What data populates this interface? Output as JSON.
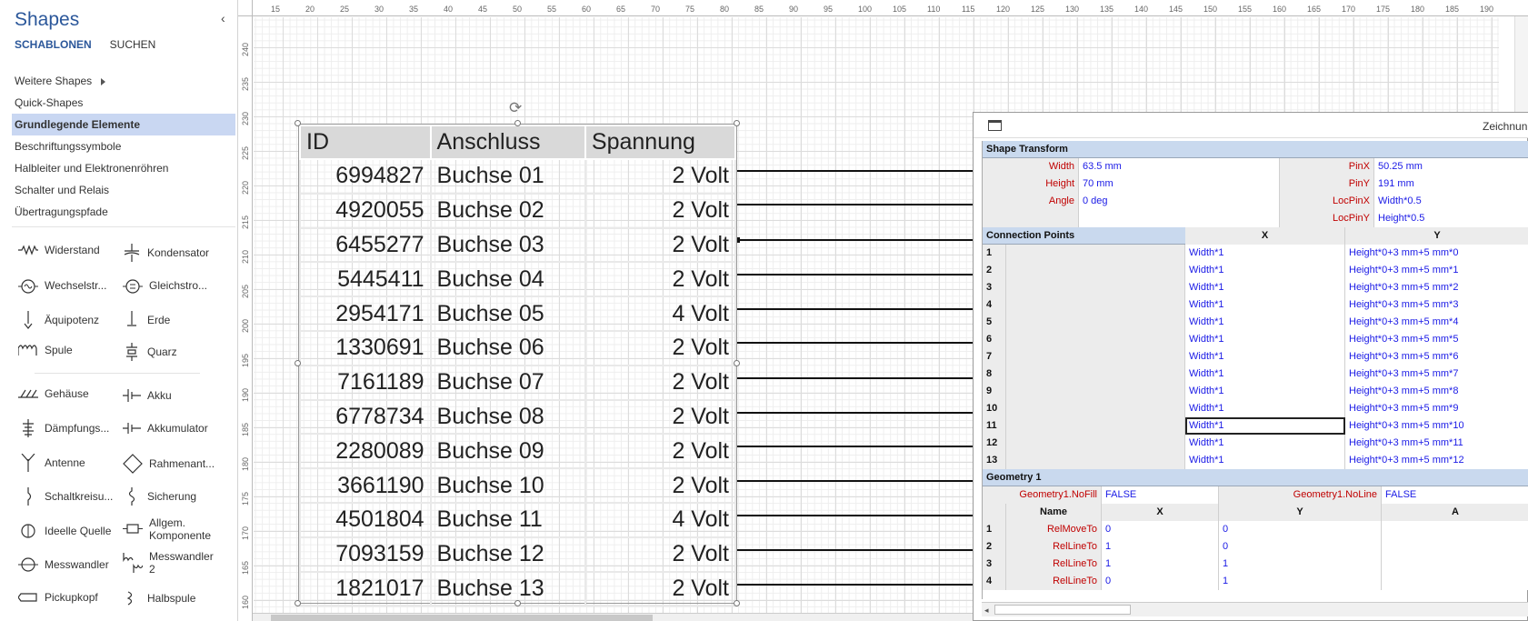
{
  "shapes_panel": {
    "title": "Shapes",
    "tabs": [
      "SCHABLONEN",
      "SUCHEN"
    ],
    "items": [
      "Weitere Shapes",
      "Quick-Shapes",
      "Grundlegende Elemente",
      "Beschriftungssymbole",
      "Halbleiter und Elektronenröhren",
      "Schalter und Relais",
      "Übertragungspfade"
    ],
    "stencils": [
      "Widerstand",
      "Kondensator",
      "Wechselstr...",
      "Gleichstro...",
      "Äquipotenz",
      "Erde",
      "Spule",
      "Quarz",
      "Gehäuse",
      "Akku",
      "Dämpfungs...",
      "Akkumulator",
      "Antenne",
      "Rahmenant...",
      "Schaltkreisu...",
      "Sicherung",
      "Ideelle Quelle",
      "Allgem. Komponente",
      "Messwandler",
      "Messwandler 2",
      "Pickupkopf",
      "Halbspule"
    ]
  },
  "rulers": {
    "horizontal": [
      "15",
      "20",
      "25",
      "30",
      "35",
      "40",
      "45",
      "50",
      "55",
      "60",
      "65",
      "70",
      "75",
      "80",
      "85",
      "90",
      "95",
      "100",
      "105",
      "110",
      "115",
      "120",
      "125",
      "130",
      "135",
      "140",
      "145",
      "150",
      "155",
      "160",
      "165",
      "170",
      "175",
      "180",
      "185",
      "190"
    ],
    "vertical": [
      "240",
      "235",
      "230",
      "225",
      "220",
      "215",
      "210",
      "205",
      "200",
      "195",
      "190",
      "185",
      "180",
      "175",
      "170",
      "165",
      "160"
    ]
  },
  "table": {
    "headers": [
      "ID",
      "Anschluss",
      "Spannung"
    ],
    "rows": [
      [
        "6994827",
        "Buchse 01",
        "2 Volt"
      ],
      [
        "4920055",
        "Buchse 02",
        "2 Volt"
      ],
      [
        "6455277",
        "Buchse 03",
        "2 Volt"
      ],
      [
        "5445411",
        "Buchse 04",
        "2 Volt"
      ],
      [
        "2954171",
        "Buchse 05",
        "4 Volt"
      ],
      [
        "1330691",
        "Buchse 06",
        "2 Volt"
      ],
      [
        "7161189",
        "Buchse 07",
        "2 Volt"
      ],
      [
        "6778734",
        "Buchse 08",
        "2 Volt"
      ],
      [
        "2280089",
        "Buchse 09",
        "2 Volt"
      ],
      [
        "3661190",
        "Buchse 10",
        "2 Volt"
      ],
      [
        "4501804",
        "Buchse 11",
        "4 Volt"
      ],
      [
        "7093159",
        "Buchse 12",
        "2 Volt"
      ],
      [
        "1821017",
        "Buchse 13",
        "2 Volt"
      ]
    ]
  },
  "shapesheet": {
    "window_title": "Zeichnun",
    "transform": {
      "title": "Shape Transform",
      "rows": [
        {
          "l1": "Width",
          "v1": "63.5 mm",
          "l2": "PinX",
          "v2": "50.25 mm"
        },
        {
          "l1": "Height",
          "v1": "70 mm",
          "l2": "PinY",
          "v2": "191 mm"
        },
        {
          "l1": "Angle",
          "v1": "0 deg",
          "l2": "LocPinX",
          "v2": "Width*0.5"
        },
        {
          "l1": "",
          "v1": "",
          "l2": "LocPinY",
          "v2": "Height*0.5"
        }
      ]
    },
    "connection": {
      "title": "Connection Points",
      "col_x": "X",
      "col_y": "Y",
      "rows": [
        {
          "i": "1",
          "x": "Width*1",
          "y": "Height*0+3 mm+5 mm*0"
        },
        {
          "i": "2",
          "x": "Width*1",
          "y": "Height*0+3 mm+5 mm*1"
        },
        {
          "i": "3",
          "x": "Width*1",
          "y": "Height*0+3 mm+5 mm*2"
        },
        {
          "i": "4",
          "x": "Width*1",
          "y": "Height*0+3 mm+5 mm*3"
        },
        {
          "i": "5",
          "x": "Width*1",
          "y": "Height*0+3 mm+5 mm*4"
        },
        {
          "i": "6",
          "x": "Width*1",
          "y": "Height*0+3 mm+5 mm*5"
        },
        {
          "i": "7",
          "x": "Width*1",
          "y": "Height*0+3 mm+5 mm*6"
        },
        {
          "i": "8",
          "x": "Width*1",
          "y": "Height*0+3 mm+5 mm*7"
        },
        {
          "i": "9",
          "x": "Width*1",
          "y": "Height*0+3 mm+5 mm*8"
        },
        {
          "i": "10",
          "x": "Width*1",
          "y": "Height*0+3 mm+5 mm*9"
        },
        {
          "i": "11",
          "x": "Width*1",
          "y": "Height*0+3 mm+5 mm*10"
        },
        {
          "i": "12",
          "x": "Width*1",
          "y": "Height*0+3 mm+5 mm*11"
        },
        {
          "i": "13",
          "x": "Width*1",
          "y": "Height*0+3 mm+5 mm*12"
        }
      ]
    },
    "geometry": {
      "title": "Geometry 1",
      "nofill_label": "Geometry1.NoFill",
      "nofill_value": "FALSE",
      "noline_label": "Geometry1.NoLine",
      "noline_value": "FALSE",
      "col_name": "Name",
      "col_x": "X",
      "col_y": "Y",
      "col_a": "A",
      "rows": [
        {
          "i": "1",
          "name": "RelMoveTo",
          "x": "0",
          "y": "0"
        },
        {
          "i": "2",
          "name": "RelLineTo",
          "x": "1",
          "y": "0"
        },
        {
          "i": "3",
          "name": "RelLineTo",
          "x": "1",
          "y": "1"
        },
        {
          "i": "4",
          "name": "RelLineTo",
          "x": "0",
          "y": "1"
        }
      ]
    }
  }
}
